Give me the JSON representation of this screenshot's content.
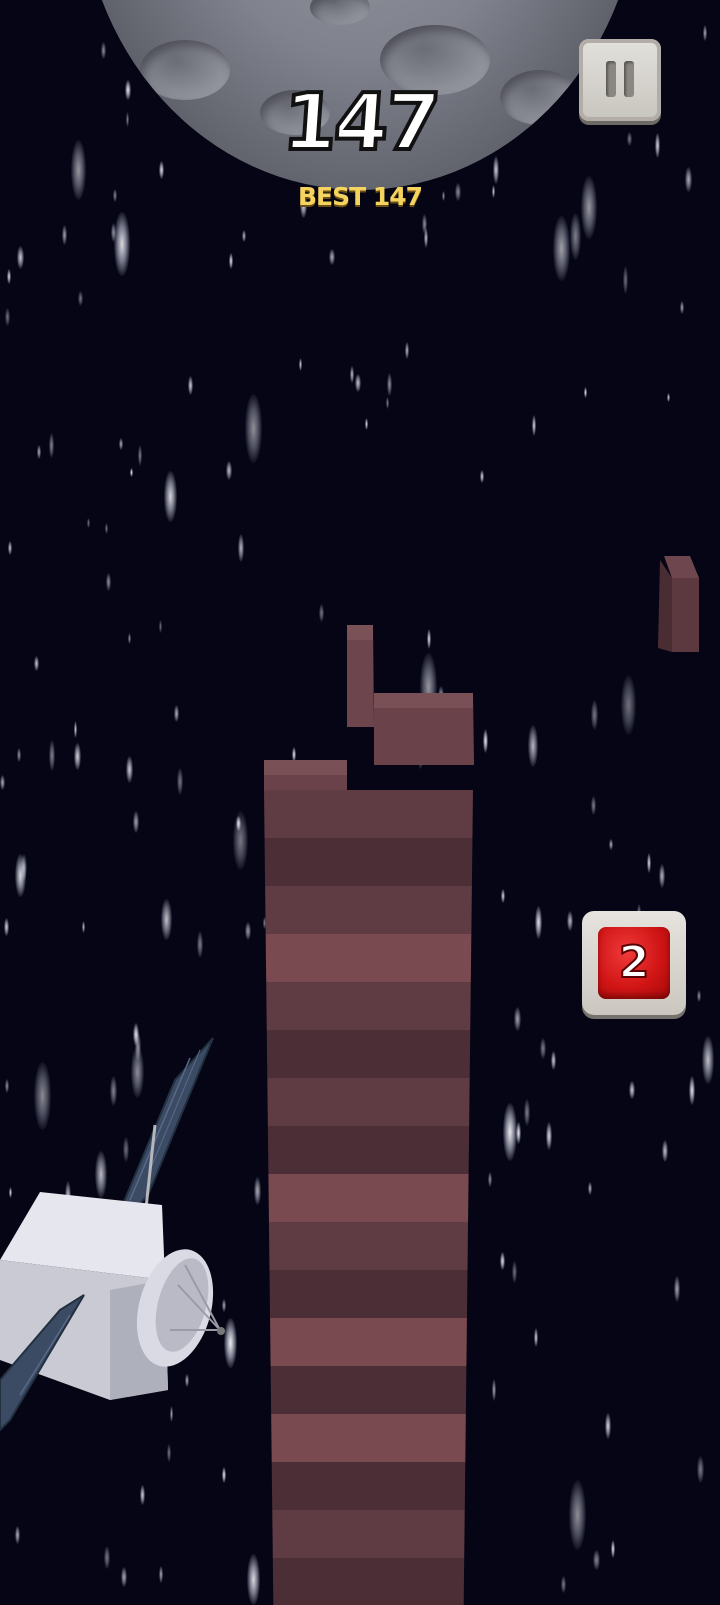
{
  "hud": {
    "score": "147",
    "best": "BEST 147"
  },
  "powerup": {
    "count": "2",
    "color": "#d11515"
  },
  "colors": {
    "background": "#050515",
    "tower_face": "#5f3b43",
    "tower_light": "#7a4a51",
    "tower_dark": "#4c2f36",
    "best_text": "#f4d35e"
  },
  "icons": {
    "pause": "pause-icon",
    "moon": "moon",
    "satellite": "satellite",
    "powerup": "powerup-block"
  }
}
